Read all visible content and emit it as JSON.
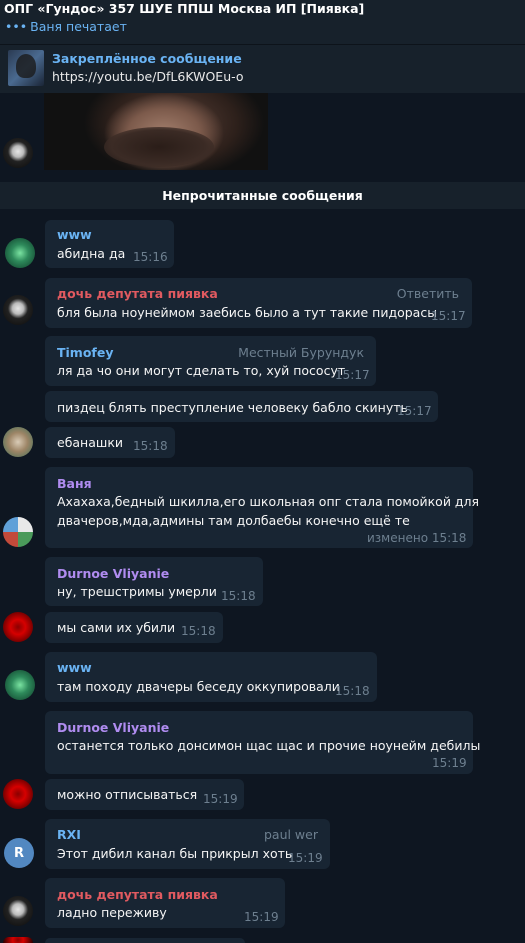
{
  "header": {
    "title": "ОПГ «Гундос» 357 ШУЕ ППШ Москва ИП [Пиявка]",
    "typing": "Ваня печатает"
  },
  "pinned": {
    "label": "Закреплённое сообщение",
    "text": "https://youtu.be/DfL6KWOEu-o"
  },
  "unread_label": "Непрочитанные сообщения",
  "messages": [
    {
      "sender": "www",
      "text": "абидна да",
      "time": "15:16"
    },
    {
      "sender": "дочь депутата пиявка",
      "side": "Ответить",
      "text": "бля была  ноунеймом заебись было а тут такие пидорасы",
      "time": "15:17"
    },
    {
      "sender": "Timofey",
      "side": "Местный Бурундук",
      "text": "ля да чо они могут сделать то, хуй пососут",
      "time": "15:17"
    },
    {
      "text": "пиздец блять преступление человеку бабло скинуть",
      "time": "15:17"
    },
    {
      "text": "ебанашки",
      "time": "15:18"
    },
    {
      "sender": "Ваня",
      "line1": "Ахахаха,бедный шкилла,его школьная опг стала помойкой для",
      "line2": "двачеров,мда,админы там долбаебы конечно ещё те",
      "time": "изменено 15:18"
    },
    {
      "sender": "Durnoe Vliyanie",
      "text": "ну, трешстримы умерли",
      "time": "15:18"
    },
    {
      "text": "мы сами их убили",
      "time": "15:18"
    },
    {
      "sender": "www",
      "text": "там походу двачеры беседу оккупировали",
      "time": "15:18"
    },
    {
      "sender": "Durnoe Vliyanie",
      "text": "останется только донсимон щас щас и прочие ноунейм дебилы",
      "time": "15:19"
    },
    {
      "text": "можно отписываться",
      "time": "15:19"
    },
    {
      "sender": "RXI",
      "side": "paul wer",
      "text": "Этот дибил канал бы прикрыл хоть",
      "time": "15:19"
    },
    {
      "sender": "дочь депутата пиявка",
      "text": "ладно переживу",
      "time": "15:19"
    }
  ],
  "avatar_initial": "R",
  "colors": {
    "background": "#0e1621",
    "panel": "#17212b",
    "bubble": "#182533",
    "accent": "#6ab3f3",
    "name_red": "#e05a60",
    "name_purple": "#b08cf0",
    "meta": "#6d7f8f"
  }
}
